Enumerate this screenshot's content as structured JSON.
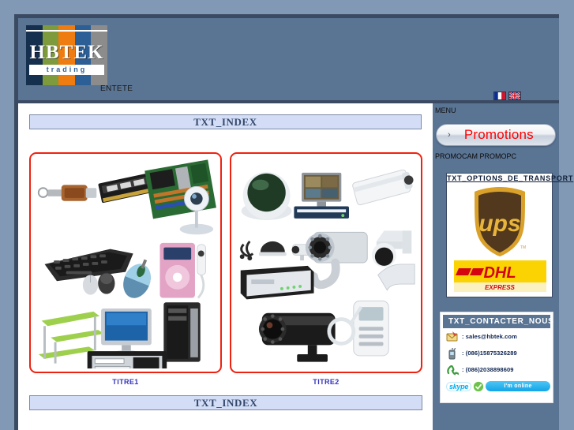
{
  "header": {
    "logo_letters": "HBTEK",
    "logo_tagline": "trading",
    "entete_label": "ENTETE",
    "flags": [
      {
        "name": "flag-fr",
        "title": "FR"
      },
      {
        "name": "flag-en",
        "title": "EN"
      }
    ]
  },
  "main": {
    "index_title_top": "TXT_INDEX",
    "index_title_bottom": "TXT_INDEX",
    "cards": [
      {
        "title": "TITRE1",
        "category": "computer-hardware"
      },
      {
        "title": "TITRE2",
        "category": "security-cameras"
      }
    ]
  },
  "sidebar": {
    "menu_label": "MENU",
    "promotions_button": "Promotions",
    "promotions_bullet": "»",
    "promo_links": "PROMOCAM PROMOPC",
    "transport": {
      "title": "TXT_OPTIONS_DE_TRANSPORT",
      "carriers": [
        "UPS",
        "DHL"
      ],
      "ups_text": "ups",
      "dhl_text": "DHL",
      "dhl_sub": "EXPRESS"
    },
    "contact": {
      "title": "TXT_CONTACTER_NOUS",
      "rows": [
        {
          "icon": "email-icon",
          "text": ": sales@hbtek.com"
        },
        {
          "icon": "mobile-phone-icon",
          "text": ": (086)15875326289"
        },
        {
          "icon": "telephone-icon",
          "text": ": (086)2038898609"
        }
      ],
      "skype_label": "skype",
      "skype_status": "I'm online"
    }
  },
  "colors": {
    "page_bg": "#8199b4",
    "frame": "#3b4a63",
    "header_bg": "#5a7494",
    "accent_red": "#ee2211",
    "index_bar_bg": "#d3ddf6",
    "title_blue": "#3333bb"
  }
}
